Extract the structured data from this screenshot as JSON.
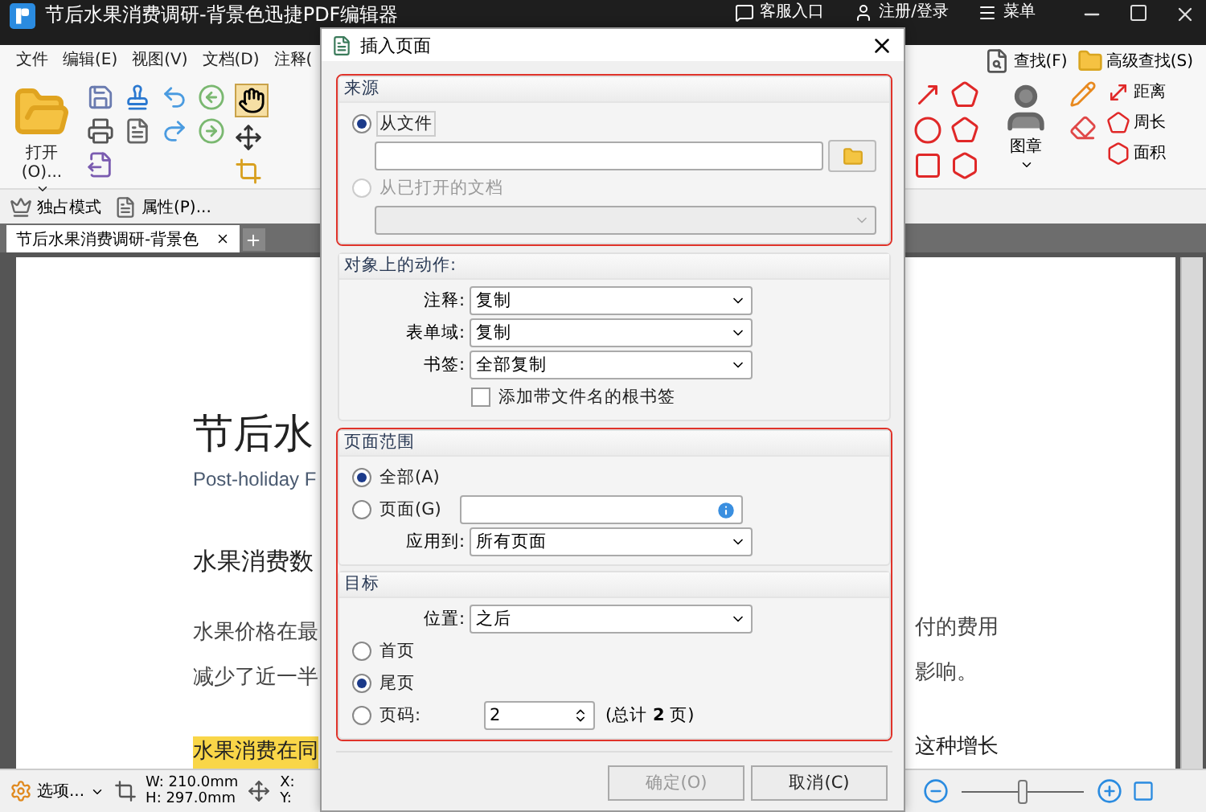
{
  "app": {
    "title": "节后水果消费调研-背景色迅捷PDF编辑器",
    "header_links": [
      {
        "kind": "service",
        "label": "客服入口"
      },
      {
        "kind": "account",
        "label": "注册/登录"
      },
      {
        "kind": "menu",
        "label": "菜单"
      }
    ]
  },
  "menu": [
    "文件",
    "编辑(E)",
    "视图(V)",
    "文档(D)",
    "注释("
  ],
  "ribbon_left": {
    "open_label": "打开(O)..."
  },
  "ribbon_right": {
    "find": "查找(F)",
    "advanced_find": "高级查找(S)",
    "stamp": "图章",
    "measure": [
      {
        "kind": "distance",
        "label": "距离"
      },
      {
        "kind": "perimeter",
        "label": "周长"
      },
      {
        "kind": "area",
        "label": "面积"
      }
    ]
  },
  "quick_bar": [
    {
      "kind": "exclusive",
      "label": "独占模式"
    },
    {
      "kind": "properties",
      "label": "属性(P)..."
    }
  ],
  "doc_tabs": [
    {
      "label": "节后水果消费调研-背景色",
      "selected": true
    }
  ],
  "document": {
    "left": [
      {
        "kind": "title",
        "text": "节后水"
      },
      {
        "kind": "subtitle",
        "text": "Post-holiday F"
      },
      {
        "kind": "heading",
        "text": "水果消费数"
      },
      {
        "kind": "body",
        "text": "水果价格在最"
      },
      {
        "kind": "body",
        "text": "减少了近一半"
      },
      {
        "kind": "highlight",
        "text": "水果消费在同"
      }
    ],
    "right": [
      {
        "kind": "body",
        "text": "付的费用"
      },
      {
        "kind": "body",
        "text": "影响。"
      },
      {
        "kind": "plain",
        "text": "这种增长"
      }
    ]
  },
  "status_bar": {
    "options": "选项...",
    "width": "W: 210.0mm",
    "height": "H: 297.0mm",
    "x": "X:",
    "y": "Y:",
    "zoom": {
      "level": 0.5
    }
  },
  "dialog": {
    "title": "插入页面",
    "frames": [
      {
        "highlighted": true,
        "groups": [
          {
            "kind": "source",
            "title": "来源",
            "options": [
              {
                "label": "从文件",
                "selected": true,
                "disabled": false
              },
              {
                "label": "从已打开的文档",
                "selected": false,
                "disabled": true
              }
            ]
          }
        ]
      },
      {
        "highlighted": false,
        "groups": [
          {
            "kind": "actions",
            "title": "对象上的动作:",
            "fields": [
              {
                "label": "注释:",
                "value": "复制"
              },
              {
                "label": "表单域:",
                "value": "复制"
              },
              {
                "label": "书签:",
                "value": "全部复制"
              }
            ],
            "checkbox": {
              "label": "添加带文件名的根书签",
              "checked": false
            }
          }
        ]
      },
      {
        "highlighted": true,
        "groups": [
          {
            "kind": "range",
            "title": "页面范围",
            "options": [
              {
                "label": "全部(A)",
                "selected": true
              },
              {
                "label": "页面(G)",
                "selected": false
              }
            ],
            "apply": {
              "label": "应用到:",
              "value": "所有页面"
            }
          },
          {
            "kind": "target",
            "title": "目标",
            "position": {
              "label": "位置:",
              "value": "之后"
            },
            "options": [
              {
                "label": "首页",
                "selected": false
              },
              {
                "label": "尾页",
                "selected": true
              },
              {
                "label": "页码:",
                "selected": false
              }
            ],
            "page_number": "2",
            "total": "(总计 **2** 页)"
          }
        ]
      }
    ],
    "buttons": [
      {
        "label": "确定(O)",
        "disabled": true
      },
      {
        "label": "取消(C)",
        "disabled": false
      }
    ]
  }
}
